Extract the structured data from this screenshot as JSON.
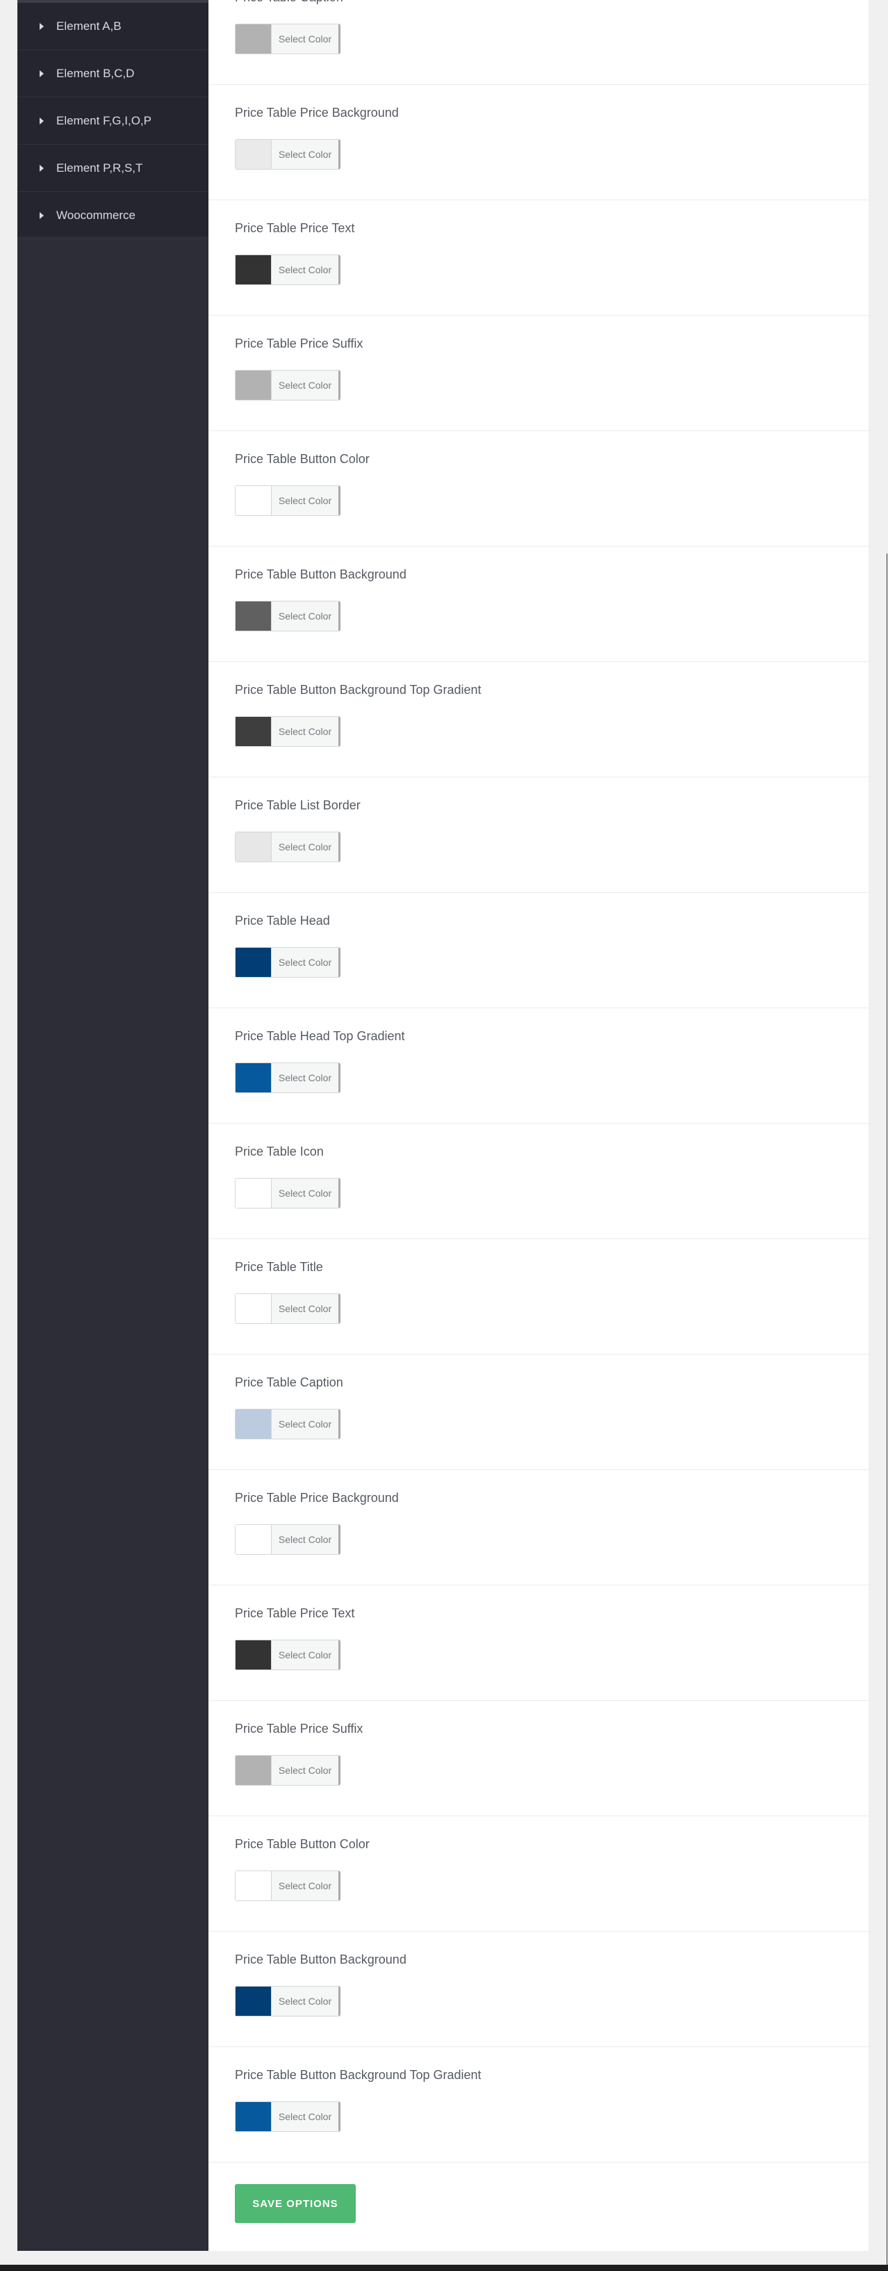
{
  "sidebar": {
    "items": [
      {
        "label": "Element A,B"
      },
      {
        "label": "Element B,C,D"
      },
      {
        "label": "Element F,G,I,O,P"
      },
      {
        "label": "Element P,R,S,T"
      },
      {
        "label": "Woocommerce"
      }
    ]
  },
  "picker_text": "Select Color",
  "options": [
    {
      "label": "Price Table Caption",
      "color": "#b2b2b2"
    },
    {
      "label": "Price Table Price Background",
      "color": "#eaeaea"
    },
    {
      "label": "Price Table Price Text",
      "color": "#333333"
    },
    {
      "label": "Price Table Price Suffix",
      "color": "#b2b2b2"
    },
    {
      "label": "Price Table Button Color",
      "color": "#ffffff"
    },
    {
      "label": "Price Table Button Background",
      "color": "#606060"
    },
    {
      "label": "Price Table Button Background Top Gradient",
      "color": "#3e3e3e"
    },
    {
      "label": "Price Table List Border",
      "color": "#e7e7e7"
    },
    {
      "label": "Price Table Head",
      "color": "#023e73"
    },
    {
      "label": "Price Table Head Top Gradient",
      "color": "#06599c"
    },
    {
      "label": "Price Table Icon",
      "color": "#ffffff"
    },
    {
      "label": "Price Table Title",
      "color": "#ffffff"
    },
    {
      "label": "Price Table Caption",
      "color": "#bccbdf"
    },
    {
      "label": "Price Table Price Background",
      "color": "#ffffff"
    },
    {
      "label": "Price Table Price Text",
      "color": "#333333"
    },
    {
      "label": "Price Table Price Suffix",
      "color": "#b2b2b2"
    },
    {
      "label": "Price Table Button Color",
      "color": "#ffffff"
    },
    {
      "label": "Price Table Button Background",
      "color": "#023e73"
    },
    {
      "label": "Price Table Button Background Top Gradient",
      "color": "#06599c"
    }
  ],
  "save_button": {
    "label": "SAVE OPTIONS"
  }
}
